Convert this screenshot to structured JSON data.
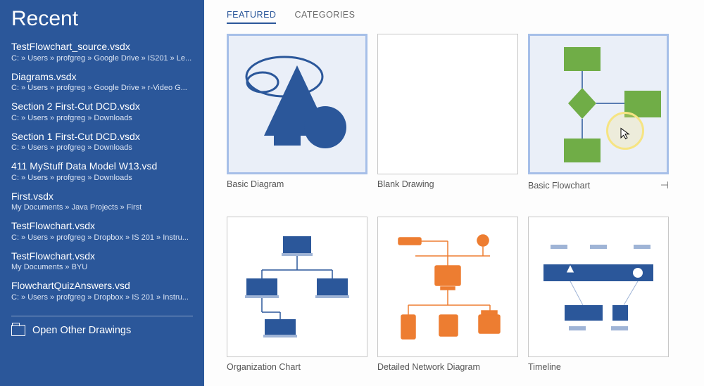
{
  "sidebar": {
    "title": "Recent",
    "items": [
      {
        "name": "TestFlowchart_source.vsdx",
        "path": "C: » Users » profgreg » Google Drive » IS201 » Le..."
      },
      {
        "name": "Diagrams.vsdx",
        "path": "C: » Users » profgreg » Google Drive » r-Video G..."
      },
      {
        "name": "Section 2 First-Cut DCD.vsdx",
        "path": "C: » Users » profgreg » Downloads"
      },
      {
        "name": "Section 1 First-Cut DCD.vsdx",
        "path": "C: » Users » profgreg » Downloads"
      },
      {
        "name": "411 MyStuff Data Model W13.vsd",
        "path": "C: » Users » profgreg » Downloads"
      },
      {
        "name": "First.vsdx",
        "path": "My Documents » Java Projects » First"
      },
      {
        "name": "TestFlowchart.vsdx",
        "path": "C: » Users » profgreg » Dropbox » IS 201 » Instru..."
      },
      {
        "name": "TestFlowchart.vsdx",
        "path": "My Documents » BYU"
      },
      {
        "name": "FlowchartQuizAnswers.vsd",
        "path": "C: » Users » profgreg » Dropbox » IS 201 » Instru..."
      }
    ],
    "open_other": "Open Other Drawings"
  },
  "main": {
    "tabs": [
      {
        "label": "FEATURED",
        "active": true
      },
      {
        "label": "CATEGORIES",
        "active": false
      }
    ],
    "templates": [
      {
        "label": "Basic Diagram",
        "kind": "basic-diagram",
        "selected": true
      },
      {
        "label": "Blank Drawing",
        "kind": "blank",
        "selected": false
      },
      {
        "label": "Basic Flowchart",
        "kind": "basic-flowchart",
        "selected": true,
        "pinned": true
      },
      {
        "label": "Organization Chart",
        "kind": "org-chart",
        "selected": false
      },
      {
        "label": "Detailed Network Diagram",
        "kind": "network",
        "selected": false
      },
      {
        "label": "Timeline",
        "kind": "timeline",
        "selected": false
      }
    ]
  },
  "colors": {
    "brand": "#2b579a",
    "green": "#70ad47",
    "orange": "#ed7d31"
  }
}
